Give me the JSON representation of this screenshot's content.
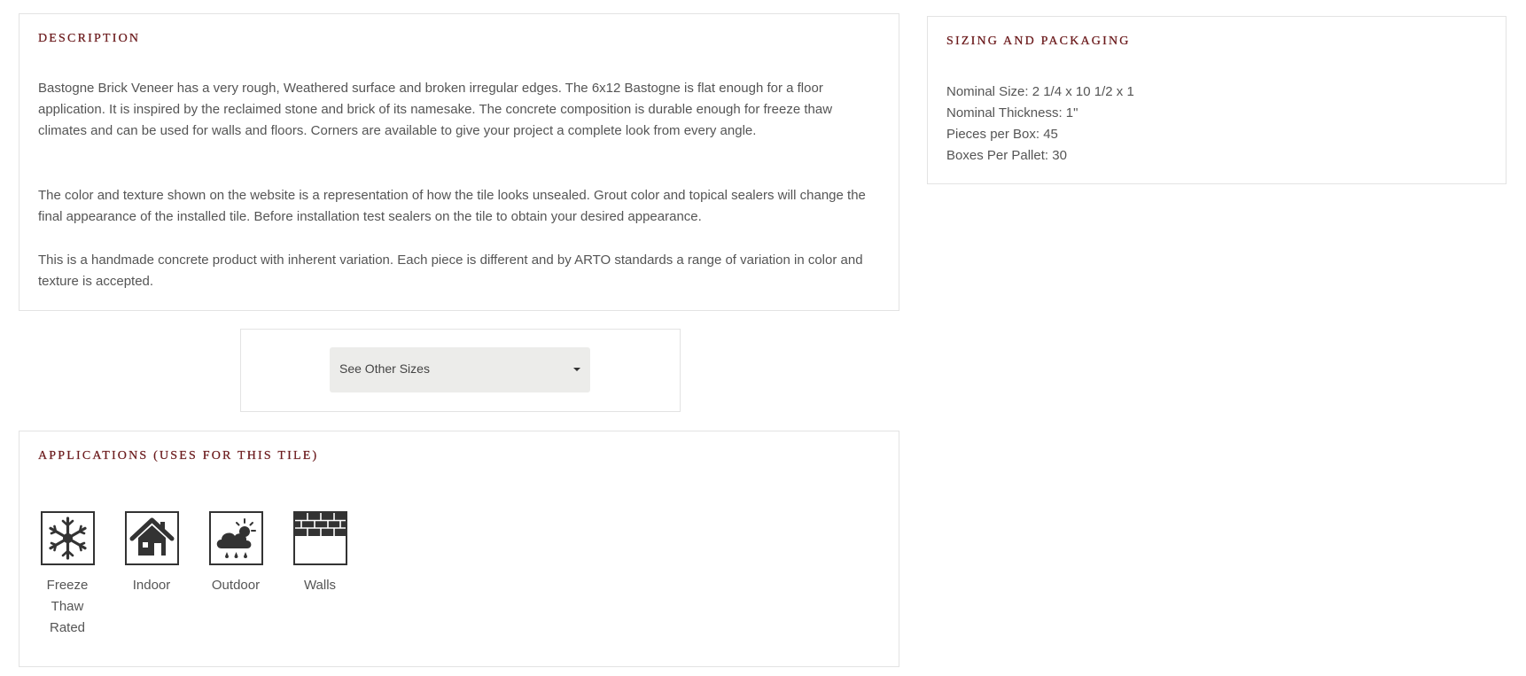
{
  "description": {
    "heading": "DESCRIPTION",
    "paragraph_1_lines": [
      "Bastogne Brick Veneer has a very rough, Weathered surface and broken irregular edges. The 6x12 Bastogne is flat enough for a floor",
      "application. It is inspired by the reclaimed stone and brick of its namesake. The concrete composition is durable enough for freeze thaw",
      "climates and can be used for walls and floors. Corners are available to give your project a complete look from every angle."
    ],
    "paragraph_2_lines": [
      "The color and texture shown on the website is a representation of how the tile looks unsealed. Grout color and topical sealers will change the",
      "final appearance of the installed tile. Before installation test sealers on the tile to obtain your desired appearance."
    ],
    "paragraph_3_lines": [
      "This is a handmade concrete product with inherent variation. Each piece is different and by ARTO standards a range of variation in color and",
      "texture is accepted."
    ]
  },
  "sizes": {
    "select_label": "See Other Sizes"
  },
  "applications": {
    "heading": "APPLICATIONS (USES FOR THIS TILE)",
    "items": [
      {
        "icon": "snowflake-icon",
        "label_lines": [
          "Freeze",
          "Thaw",
          "Rated"
        ]
      },
      {
        "icon": "house-icon",
        "label_lines": [
          "Indoor"
        ]
      },
      {
        "icon": "weather-icon",
        "label_lines": [
          "Outdoor"
        ]
      },
      {
        "icon": "brick-wall-icon",
        "label_lines": [
          "Walls"
        ]
      }
    ]
  },
  "sizing": {
    "heading": "SIZING AND PACKAGING",
    "specs": [
      "Nominal Size: 2 1/4 x 10 1/2 x 1",
      "Nominal Thickness: 1\"",
      "Pieces per Box: 45",
      "Boxes Per Pallet: 30"
    ]
  },
  "colors": {
    "heading": "#6b1a1c",
    "text": "#555555",
    "border": "#e3e3e3",
    "select_bg": "#ececea",
    "icon": "#333333"
  }
}
